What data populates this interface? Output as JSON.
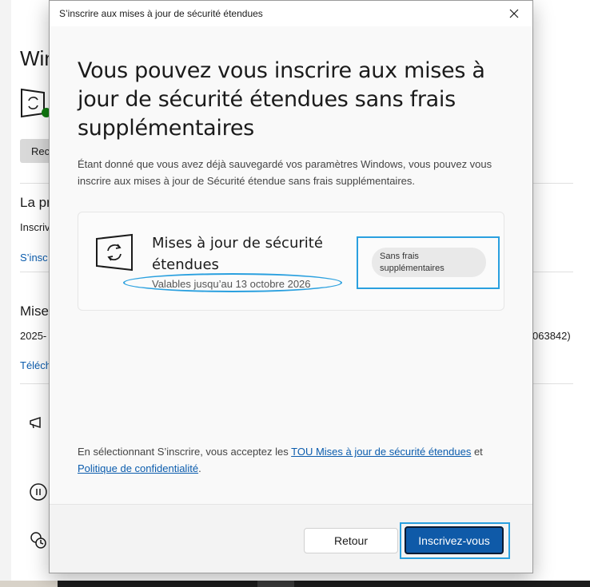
{
  "background": {
    "title": "Win",
    "restart_button": "Rec",
    "section1_heading": "La pr",
    "section1_text": "Inscriv",
    "section1_link": "S’insc",
    "section2_heading": "Mise",
    "section2_text": "2025-",
    "section2_kb": "063842)",
    "section2_link": "Téléch"
  },
  "dialog": {
    "window_title": "S’inscrire aux mises à jour de sécurité étendues",
    "close_icon": "close-icon",
    "heading": "Vous pouvez vous inscrire aux mises à jour de sécurité étendues sans frais supplémentaires",
    "description": "Étant donné que vous avez déjà sauvegardé vos paramètres Windows, vous pouvez vous inscrire aux mises à jour de Sécurité étendue sans frais supplémentaires.",
    "card": {
      "icon": "sync-update-icon",
      "title": "Mises à jour de sécurité étendues",
      "subtitle": "Valables jusqu’au 13 octobre 2026",
      "badge": "Sans frais supplémentaires"
    },
    "terms": {
      "prefix": "En sélectionnant S’inscrire, vous acceptez les ",
      "tou_link": "TOU Mises à jour de sécurité étendues",
      "middle": " et ",
      "privacy_link": "Politique de confidentialité",
      "suffix": "."
    },
    "buttons": {
      "back": "Retour",
      "enroll": "Inscrivez-vous"
    }
  },
  "colors": {
    "accent": "#0f5aa8",
    "link": "#0b5cad",
    "annotation": "#2aa0df"
  }
}
